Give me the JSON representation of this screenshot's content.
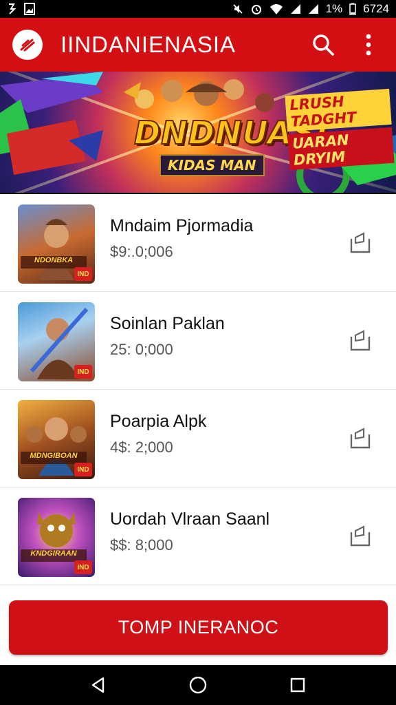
{
  "status_bar": {
    "left_icons": [
      "notification-icon",
      "image-icon"
    ],
    "right_icons": [
      "mute-icon",
      "alarm-icon",
      "wifi-icon",
      "signal-icon",
      "signal-icon"
    ],
    "battery": "1%",
    "time": "6724"
  },
  "app_bar": {
    "title": "IINDANIENASIA",
    "logo_icon": "logo-icon",
    "search_icon": "search-icon",
    "menu_icon": "more-vert-icon",
    "color": "#d40f14"
  },
  "banner": {
    "title": "DNDNUASI",
    "subtitle": "KIDAS MAN",
    "promo_line1": "LRUSH TADGHT",
    "promo_line2": "UARAN DRYIM"
  },
  "items": [
    {
      "name": "Mndaim Pjormadia",
      "price": "$9:.0;006",
      "thumb_label": "NDONBKA",
      "tag": "IND",
      "share_icon": "share-icon"
    },
    {
      "name": "Soinlan Paklan",
      "price": "25: 0;000",
      "thumb_label": "",
      "tag": "IND",
      "share_icon": "share-icon"
    },
    {
      "name": "Poarpia Alpk",
      "price": "4$: 2;000",
      "thumb_label": "MDNGIBOAN",
      "tag": "IND",
      "share_icon": "share-icon"
    },
    {
      "name": "Uordah Vlraan Saanl",
      "price": "$$: 8;000",
      "thumb_label": "KNDGIRAAN",
      "tag": "IND",
      "share_icon": "share-icon"
    }
  ],
  "cta": {
    "label": "TOMP INERANOC",
    "color": "#cf1016"
  },
  "nav_bar": {
    "back_icon": "back-icon",
    "home_icon": "home-icon",
    "recents_icon": "recents-icon"
  }
}
